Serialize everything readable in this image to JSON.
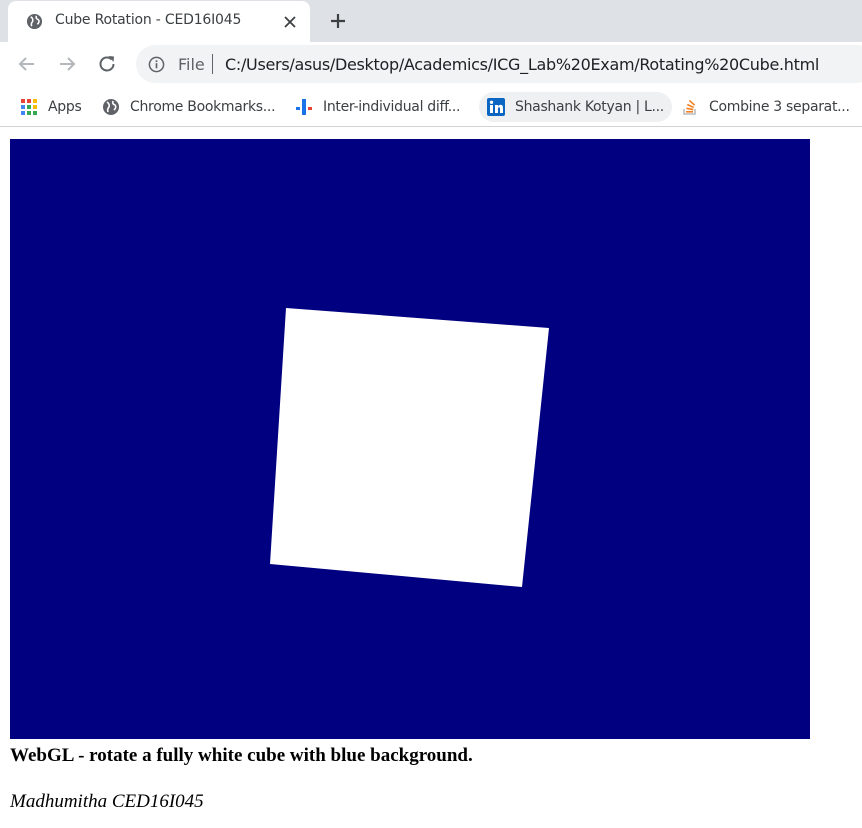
{
  "browser": {
    "tab": {
      "title": "Cube Rotation - CED16I045",
      "favicon": "globe-icon",
      "close_icon": "close-icon"
    },
    "new_tab_icon": "plus-icon",
    "toolbar": {
      "back_icon": "back-arrow-icon",
      "forward_icon": "forward-arrow-icon",
      "reload_icon": "reload-icon",
      "info_icon": "info-icon",
      "scheme_label": "File",
      "url": "C:/Users/asus/Desktop/Academics/ICG_Lab%20Exam/Rotating%20Cube.html"
    },
    "bookmarks": [
      {
        "label": "Apps",
        "icon": "apps-grid-icon"
      },
      {
        "label": "Chrome Bookmarks...",
        "icon": "globe-icon"
      },
      {
        "label": "Inter-individual diff...",
        "icon": "chart-bars-icon"
      },
      {
        "label": "Shashank Kotyan | L...",
        "icon": "linkedin-icon"
      },
      {
        "label": "Combine 3 separat...",
        "icon": "stack-overflow-icon"
      }
    ]
  },
  "page": {
    "canvas": {
      "background_color": "#000080",
      "shape_color": "#ffffff"
    },
    "caption": "WebGL - rotate a fully white cube with blue background.",
    "author": "Madhumitha CED16I045"
  }
}
